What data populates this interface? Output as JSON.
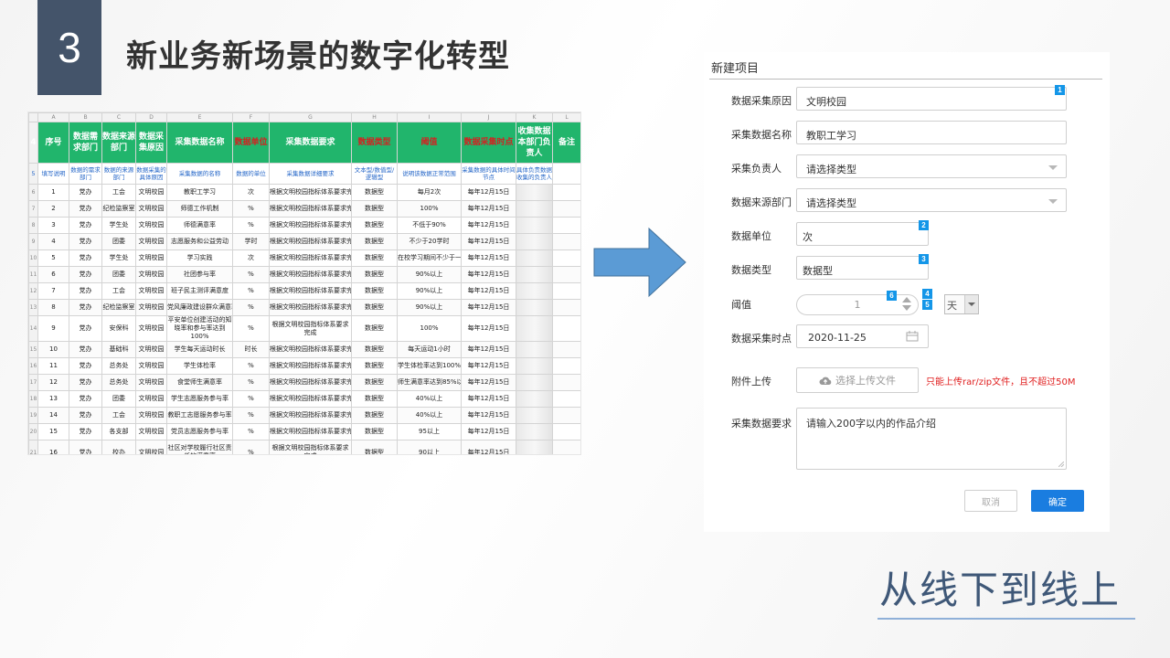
{
  "slide": {
    "number": "3",
    "title": "新业务新场景的数字化转型",
    "subtitle": "从线下到线上"
  },
  "sheet": {
    "col_letters": [
      "",
      "A",
      "B",
      "C",
      "D",
      "E",
      "F",
      "G",
      "H",
      "I",
      "J",
      "K",
      "L"
    ],
    "headers": [
      "序号",
      "数据需求部门",
      "数据来源部门",
      "数据采集原因",
      "采集数据名称",
      "数据单位",
      "采集数据要求",
      "数据类型",
      "阈值",
      "数据采集时点",
      "收集数据本部门负责人",
      "备注"
    ],
    "subheaders": [
      "填写说明",
      "数据的需求部门",
      "数据的来源部门",
      "数据采集的具体原因",
      "采集数据的名称",
      "数据的单位",
      "采集数据详细要求",
      "文本型/数值型/逻辑型",
      "说明该数据正常范围",
      "采集数据的具体时间节点",
      "具体负责数据收集的负责人",
      ""
    ],
    "rows": [
      {
        "rn": "6",
        "cells": [
          "1",
          "党办",
          "工会",
          "文明校园",
          "教职工学习",
          "次",
          "根据文明校园指标体系要求完成",
          "数据型",
          "每月2次",
          "每年12月15日",
          "",
          ""
        ]
      },
      {
        "rn": "7",
        "cells": [
          "2",
          "党办",
          "纪检监察室",
          "文明校园",
          "师德工作机制",
          "%",
          "根据文明校园指标体系要求完成",
          "数据型",
          "100%",
          "每年12月15日",
          "",
          ""
        ]
      },
      {
        "rn": "8",
        "cells": [
          "3",
          "党办",
          "学生处",
          "文明校园",
          "师德满意率",
          "%",
          "根据文明校园指标体系要求完成",
          "数据型",
          "不低于90%",
          "每年12月15日",
          "",
          ""
        ]
      },
      {
        "rn": "9",
        "cells": [
          "4",
          "党办",
          "团委",
          "文明校园",
          "志愿服务和公益劳动",
          "学时",
          "根据文明校园指标体系要求完成",
          "数据型",
          "不少于20学时",
          "每年12月15日",
          "",
          ""
        ]
      },
      {
        "rn": "10",
        "cells": [
          "5",
          "党办",
          "学生处",
          "文明校园",
          "学习实践",
          "次",
          "根据文明校园指标体系要求完成",
          "数据型",
          "在校学习期间不少于一次",
          "每年12月15日",
          "",
          ""
        ]
      },
      {
        "rn": "11",
        "cells": [
          "6",
          "党办",
          "团委",
          "文明校园",
          "社团参与率",
          "%",
          "根据文明校园指标体系要求完成",
          "数据型",
          "90%以上",
          "每年12月15日",
          "",
          ""
        ]
      },
      {
        "rn": "12",
        "cells": [
          "7",
          "党办",
          "工会",
          "文明校园",
          "班子民主测评满意度",
          "%",
          "根据文明校园指标体系要求完成",
          "数据型",
          "90%以上",
          "每年12月15日",
          "",
          ""
        ]
      },
      {
        "rn": "13",
        "cells": [
          "8",
          "党办",
          "纪检监察室",
          "文明校园",
          "党风廉政建设群众满意率",
          "%",
          "根据文明校园指标体系要求完成",
          "数据型",
          "90%以上",
          "每年12月15日",
          "",
          ""
        ]
      },
      {
        "rn": "14",
        "cells": [
          "9",
          "党办",
          "安保科",
          "文明校园",
          "平安单位创建活动的知晓率和参与率达到100%",
          "%",
          "根据文明校园指标体系要求完成",
          "数据型",
          "100%",
          "每年12月15日",
          "",
          ""
        ]
      },
      {
        "rn": "15",
        "cells": [
          "10",
          "党办",
          "基础科",
          "文明校园",
          "学生每天运动时长",
          "时长",
          "根据文明校园指标体系要求完成",
          "数据型",
          "每天运动1小时",
          "每年12月15日",
          "",
          ""
        ]
      },
      {
        "rn": "16",
        "cells": [
          "11",
          "党办",
          "总务处",
          "文明校园",
          "学生体检率",
          "%",
          "根据文明校园指标体系要求完成",
          "数据型",
          "学生体检率达到100%",
          "每年12月15日",
          "",
          ""
        ]
      },
      {
        "rn": "17",
        "cells": [
          "12",
          "党办",
          "总务处",
          "文明校园",
          "食堂师生满意率",
          "%",
          "根据文明校园指标体系要求完成",
          "数据型",
          "师生满意率达到85%以上",
          "每年12月15日",
          "",
          ""
        ]
      },
      {
        "rn": "18",
        "cells": [
          "13",
          "党办",
          "团委",
          "文明校园",
          "学生志愿服务参与率",
          "%",
          "根据文明校园指标体系要求完成",
          "数据型",
          "40%以上",
          "每年12月15日",
          "",
          ""
        ]
      },
      {
        "rn": "19",
        "cells": [
          "14",
          "党办",
          "工会",
          "文明校园",
          "教职工志愿服务参与率",
          "%",
          "根据文明校园指标体系要求完成",
          "数据型",
          "40%以上",
          "每年12月15日",
          "",
          ""
        ]
      },
      {
        "rn": "20",
        "cells": [
          "15",
          "党办",
          "各支部",
          "文明校园",
          "党员志愿服务参与率",
          "%",
          "根据文明校园指标体系要求完成",
          "数据型",
          "95以上",
          "每年12月15日",
          "",
          ""
        ]
      },
      {
        "rn": "21",
        "cells": [
          "16",
          "党办",
          "校办",
          "文明校园",
          "社区对学校履行社区责任的满意率",
          "%",
          "根据文明校园指标体系要求完成",
          "数据型",
          "90以上",
          "每年12月15日",
          "",
          ""
        ]
      }
    ]
  },
  "form": {
    "title": "新建项目",
    "labels": {
      "reason": "数据采集原因",
      "name": "采集数据名称",
      "owner": "采集负责人",
      "source": "数据来源部门",
      "unit": "数据单位",
      "type": "数据类型",
      "threshold": "阈值",
      "time": "数据采集时点",
      "attachment": "附件上传",
      "requirement": "采集数据要求"
    },
    "values": {
      "reason": "文明校园",
      "name": "教职工学习",
      "owner": "请选择类型",
      "source": "请选择类型",
      "unit": "次",
      "type": "数据型",
      "threshold": "1",
      "threshold_unit": "天",
      "time": "2020-11-25",
      "requirement": "请输入200字以内的作品介绍"
    },
    "badges": [
      "1",
      "2",
      "3",
      "4",
      "5",
      "6"
    ],
    "upload_label": "选择上传文件",
    "upload_hint": "只能上传rar/zip文件，且不超过50M",
    "cancel_label": "取消",
    "ok_label": "确定"
  },
  "colors": {
    "accent": "#1a7de0",
    "header_green": "#21b56c",
    "title_box": "#44546a",
    "arrow": "#5b9bd5"
  }
}
